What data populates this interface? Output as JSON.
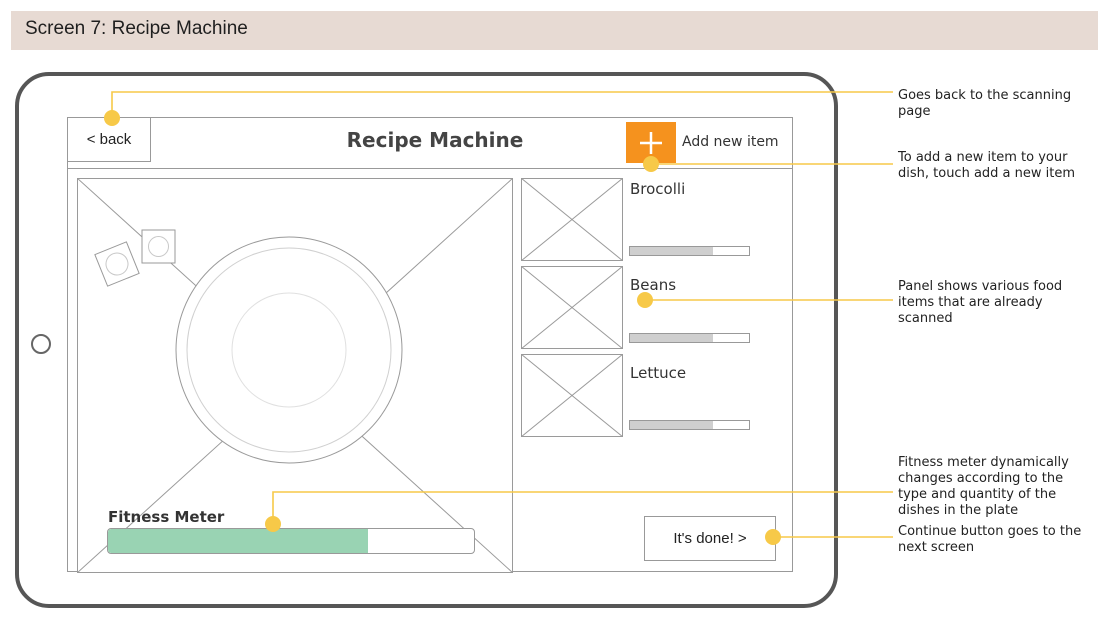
{
  "banner": {
    "title": "Screen 7: Recipe Machine"
  },
  "app": {
    "title": "Recipe Machine",
    "back_label": "< back",
    "add_label": "Add new item",
    "add_icon": "plus-icon",
    "accent_color": "#f5921e"
  },
  "food_panel": {
    "items": [
      {
        "name": "Brocolli",
        "level": 0.7
      },
      {
        "name": "Beans",
        "level": 0.7
      },
      {
        "name": "Lettuce",
        "level": 0.7
      }
    ]
  },
  "fitness": {
    "label": "Fitness Meter",
    "level": 0.71,
    "color": "#99d3b3"
  },
  "done_label": "It's done! >",
  "annotations": {
    "back": [
      "Goes back to the scanning",
      "page"
    ],
    "add": [
      "To add a new item to your",
      "dish, touch add a new item"
    ],
    "panel": [
      "Panel shows various food",
      "items that are already",
      "scanned"
    ],
    "fitness": [
      "Fitness meter dynamically",
      "changes according to the",
      "type and quantity of the",
      "dishes in the plate"
    ],
    "continue": [
      "Continue button goes to the",
      "next screen"
    ],
    "marker_color": "#f7c948"
  }
}
